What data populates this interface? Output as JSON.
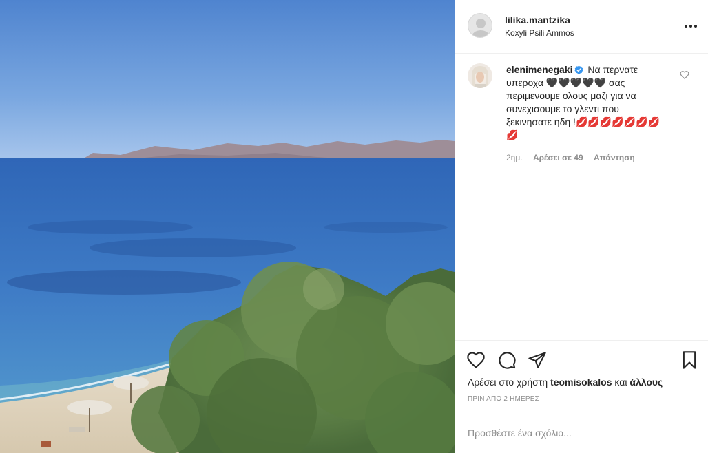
{
  "post": {
    "username": "lilika.mantzika",
    "location": "Koxyli Psili Ammos",
    "more_icon": "more-options-icon",
    "image_subject": "sea view with beach, umbrellas and trees"
  },
  "comment": {
    "username": "elenimenegaki",
    "verified": true,
    "text": "Να περνατε υπεροχα 🖤🖤🖤🖤🖤 σας περιμενουμε ολους μαζι για να συνεχισουμε το γλεντι που ξεκινησατε ηδη !💋💋💋💋💋💋💋💋",
    "time": "2ημ.",
    "likes": "Αρέσει σε 49",
    "reply": "Απάντηση"
  },
  "actions": {
    "like_icon": "heart-icon",
    "comment_icon": "comment-icon",
    "share_icon": "share-icon",
    "save_icon": "bookmark-icon"
  },
  "likes_line": {
    "prefix": "Αρέσει στο χρήστη",
    "user": "teomisokalos",
    "connector": "και",
    "others": "άλλους"
  },
  "timestamp": "ΠΡΙΝ ΑΠΟ 2 ΗΜΕΡΕΣ",
  "add_comment": {
    "placeholder": "Προσθέστε ένα σχόλιο..."
  },
  "colors": {
    "text": "#262626",
    "secondary": "#8e8e8e",
    "verified": "#3897f0",
    "border": "#efefef"
  }
}
